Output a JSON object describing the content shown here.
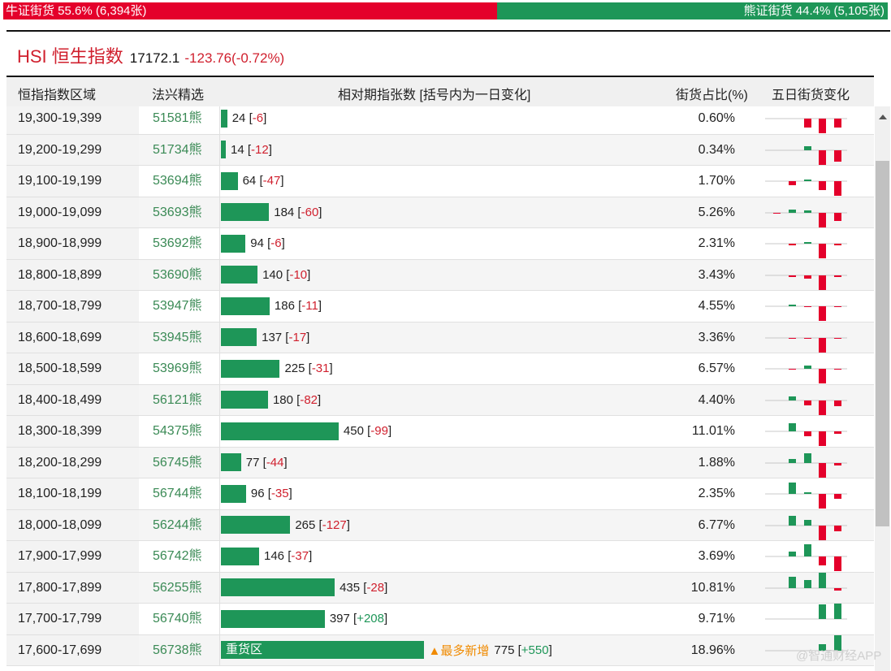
{
  "ratio": {
    "bull_label": "牛证街货 55.6% (6,394张)",
    "bull_pct": 55.6,
    "bear_label": "熊证街货 44.4% (5,105张)",
    "bear_pct": 44.4
  },
  "index": {
    "name": "HSI 恒生指数",
    "price": "17172.1",
    "change": "-123.76(-0.72%)"
  },
  "headers": {
    "range": "恒指指数区域",
    "pick": "法兴精选",
    "count": "相对期指张数 [括号内为一日变化]",
    "share": "街货占比(%)",
    "five": "五日街货变化"
  },
  "heavy_label": "重货区",
  "most_new_label": "▲最多新增",
  "rows": [
    {
      "range": "19,300-19,399",
      "pick": "51581熊",
      "count": 24,
      "count_text": "24",
      "chg": "-6",
      "share": "0.60%",
      "five": [
        0,
        0,
        -11,
        -18,
        -11
      ]
    },
    {
      "range": "19,200-19,299",
      "pick": "51734熊",
      "count": 14,
      "count_text": "14",
      "chg": "-12",
      "share": "0.34%",
      "five": [
        0,
        0,
        5,
        -19,
        -14
      ]
    },
    {
      "range": "19,100-19,199",
      "pick": "53694熊",
      "count": 64,
      "count_text": "64",
      "chg": "-47",
      "share": "1.70%",
      "five": [
        0,
        -5,
        2,
        -11,
        -18
      ]
    },
    {
      "range": "19,000-19,099",
      "pick": "53693熊",
      "count": 184,
      "count_text": "184",
      "chg": "-60",
      "share": "5.26%",
      "five": [
        -1,
        4,
        3,
        -19,
        -10
      ]
    },
    {
      "range": "18,900-18,999",
      "pick": "53692熊",
      "count": 94,
      "count_text": "94",
      "chg": "-6",
      "share": "2.31%",
      "five": [
        0,
        -2,
        2,
        -18,
        -2
      ]
    },
    {
      "range": "18,800-18,899",
      "pick": "53690熊",
      "count": 140,
      "count_text": "140",
      "chg": "-10",
      "share": "3.43%",
      "five": [
        0,
        -2,
        -4,
        -19,
        -2
      ]
    },
    {
      "range": "18,700-18,799",
      "pick": "53947熊",
      "count": 186,
      "count_text": "186",
      "chg": "-11",
      "share": "4.55%",
      "five": [
        0,
        2,
        -1,
        -18,
        -1
      ]
    },
    {
      "range": "18,600-18,699",
      "pick": "53945熊",
      "count": 137,
      "count_text": "137",
      "chg": "-17",
      "share": "3.36%",
      "five": [
        0,
        -1,
        -1,
        -19,
        -1
      ]
    },
    {
      "range": "18,500-18,599",
      "pick": "53969熊",
      "count": 225,
      "count_text": "225",
      "chg": "-31",
      "share": "6.57%",
      "five": [
        0,
        -1,
        4,
        -18,
        -1
      ]
    },
    {
      "range": "18,400-18,499",
      "pick": "56121熊",
      "count": 180,
      "count_text": "180",
      "chg": "-82",
      "share": "4.40%",
      "five": [
        0,
        5,
        -6,
        -19,
        -7
      ]
    },
    {
      "range": "18,300-18,399",
      "pick": "54375熊",
      "count": 450,
      "count_text": "450",
      "chg": "-99",
      "share": "11.01%",
      "five": [
        0,
        10,
        -6,
        -18,
        -3
      ]
    },
    {
      "range": "18,200-18,299",
      "pick": "56745熊",
      "count": 77,
      "count_text": "77",
      "chg": "-44",
      "share": "1.88%",
      "five": [
        0,
        5,
        12,
        -19,
        -3
      ]
    },
    {
      "range": "18,100-18,199",
      "pick": "56744熊",
      "count": 96,
      "count_text": "96",
      "chg": "-35",
      "share": "2.35%",
      "five": [
        0,
        14,
        2,
        -18,
        -6
      ]
    },
    {
      "range": "18,000-18,099",
      "pick": "56244熊",
      "count": 265,
      "count_text": "265",
      "chg": "-127",
      "share": "6.77%",
      "five": [
        0,
        12,
        7,
        -19,
        -7
      ]
    },
    {
      "range": "17,900-17,999",
      "pick": "56742熊",
      "count": 146,
      "count_text": "146",
      "chg": "-37",
      "share": "3.69%",
      "five": [
        0,
        6,
        15,
        -11,
        -18
      ]
    },
    {
      "range": "17,800-17,899",
      "pick": "56255熊",
      "count": 435,
      "count_text": "435",
      "chg": "-28",
      "share": "10.81%",
      "five": [
        0,
        14,
        10,
        19,
        -3
      ]
    },
    {
      "range": "17,700-17,799",
      "pick": "56740熊",
      "count": 397,
      "count_text": "397",
      "chg": "+208",
      "share": "9.71%",
      "five": [
        0,
        0,
        0,
        18,
        19
      ]
    },
    {
      "range": "17,600-17,699",
      "pick": "56738熊",
      "count": 775,
      "count_text": "775",
      "chg": "+550",
      "share": "18.96%",
      "five": [
        0,
        0,
        0,
        8,
        19
      ],
      "heavy": true
    }
  ],
  "watermark": "@智通财经APP",
  "colors": {
    "red": "#e4002b",
    "green": "#1e9658"
  }
}
